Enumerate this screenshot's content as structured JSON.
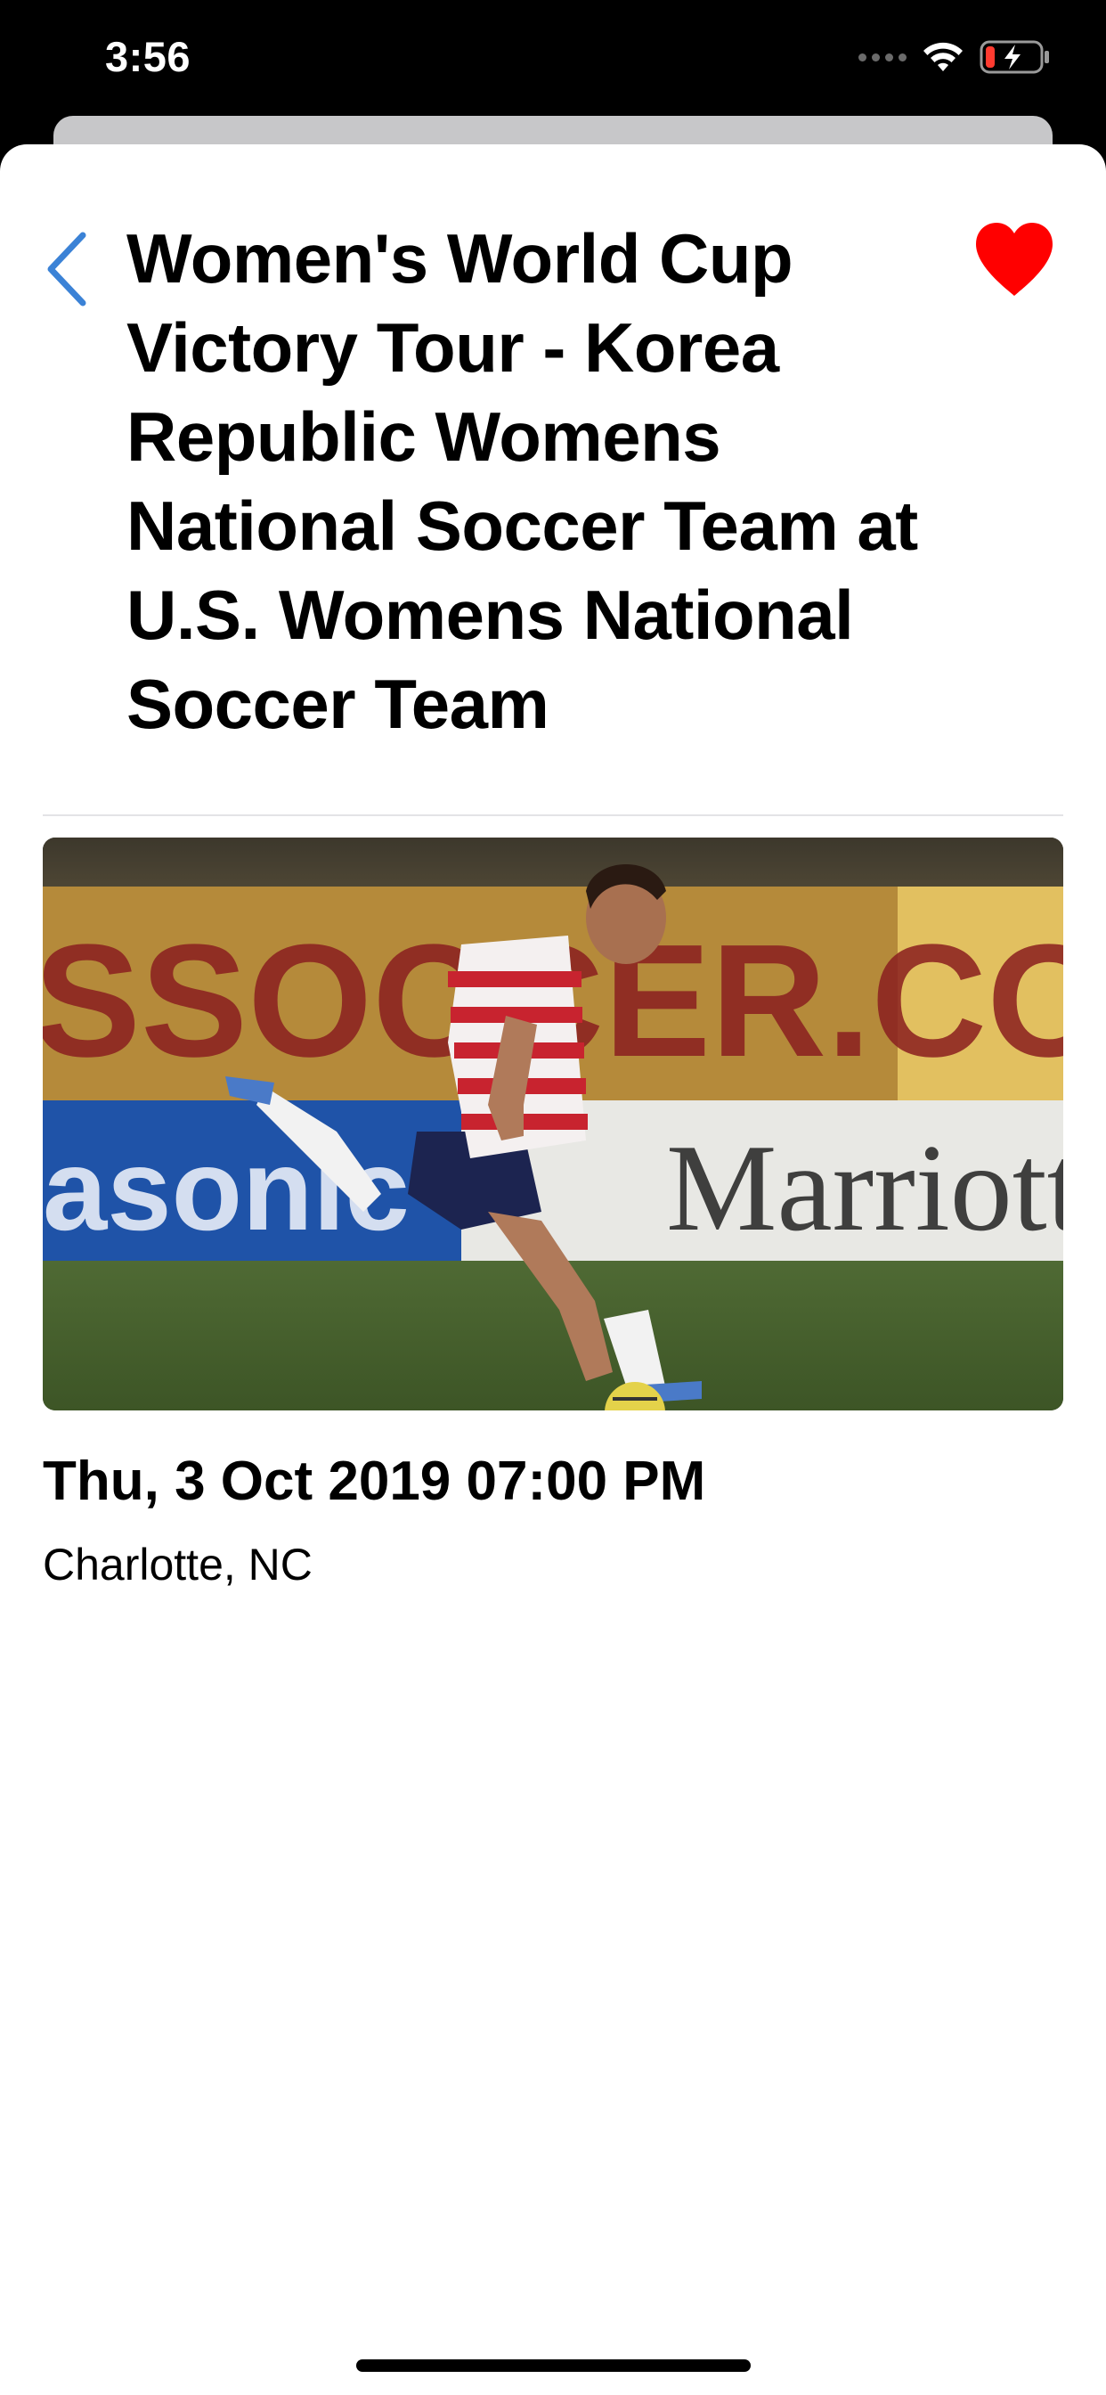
{
  "status_bar": {
    "time": "3:56",
    "icons": [
      "cellular-signal-icon",
      "wifi-icon",
      "battery-charging-icon"
    ]
  },
  "header": {
    "back_icon": "chevron-left-icon",
    "favorite_icon": "heart-icon",
    "title": "Women's World Cup Victory Tour - Korea Republic Womens National Soccer Team at U.S. Womens National Soccer Team"
  },
  "event": {
    "datetime": "Thu, 3 Oct 2019 07:00 PM",
    "location": "Charlotte, NC"
  },
  "image": {
    "description_icon": "event-photo",
    "banner_text_top": "SSOCCER.COM",
    "banner_text_left": "asonic",
    "banner_text_right": "Marriott"
  },
  "colors": {
    "accent": "#3478f6",
    "favorite": "#ff0000",
    "text": "#000000",
    "background": "#ffffff"
  }
}
